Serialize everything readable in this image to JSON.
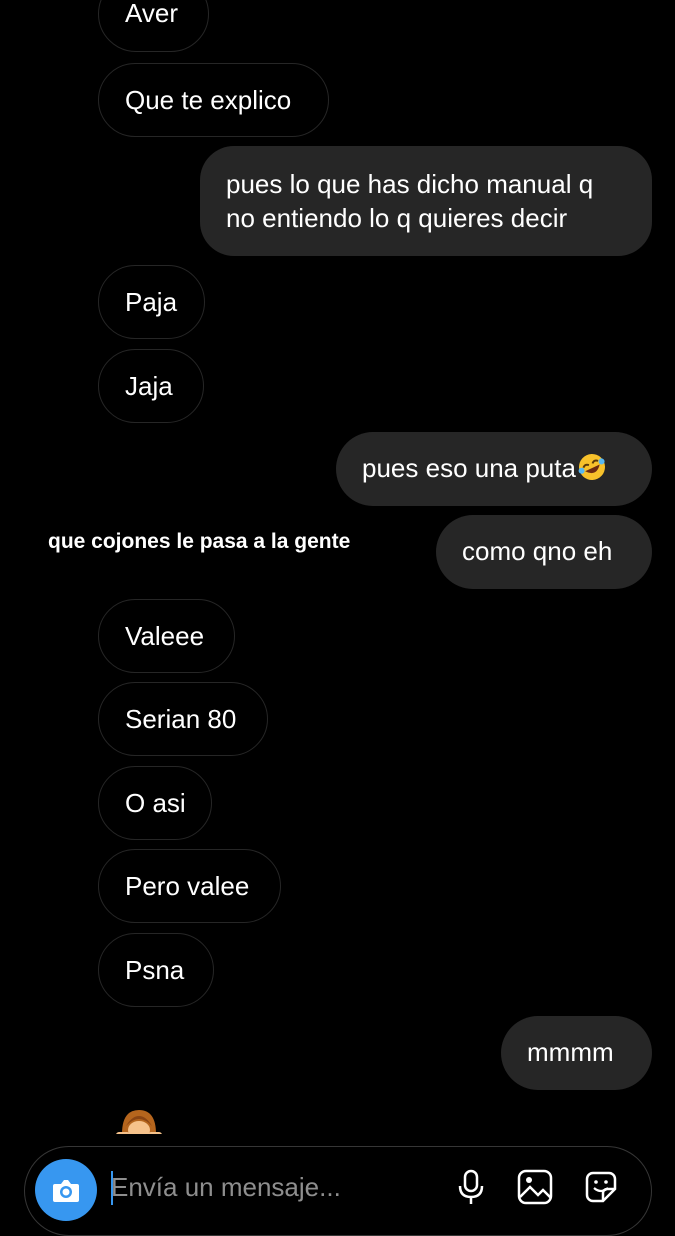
{
  "conversation": {
    "messages": [
      {
        "sender": "them",
        "text": "Aver"
      },
      {
        "sender": "them",
        "text": "Que te explico"
      },
      {
        "sender": "me",
        "text": "pues lo que has dicho manual q no entiendo lo q quieres decir"
      },
      {
        "sender": "them",
        "text": "Paja"
      },
      {
        "sender": "them",
        "text": "Jaja"
      },
      {
        "sender": "me",
        "text": "pues eso una puta",
        "emoji": "rolling-on-floor-laughing-emoji"
      },
      {
        "sender": "me",
        "text": "como qno eh"
      },
      {
        "sender": "them",
        "text": "Valeee"
      },
      {
        "sender": "them",
        "text": "Serian 80"
      },
      {
        "sender": "them",
        "text": "O asi"
      },
      {
        "sender": "them",
        "text": "Pero valee"
      },
      {
        "sender": "them",
        "text": "Psna"
      },
      {
        "sender": "me",
        "text": "mmmm"
      }
    ]
  },
  "overlay_caption": "que cojones le pasa a la gente",
  "composer": {
    "placeholder": "Envía un mensaje...",
    "icons": [
      "camera-icon",
      "microphone-icon",
      "gallery-icon",
      "sticker-icon"
    ]
  },
  "colors": {
    "background": "#000000",
    "outgoing_bubble": "#262626",
    "incoming_border": "#262626",
    "accent": "#3797f0",
    "placeholder": "#8e8e8e"
  }
}
